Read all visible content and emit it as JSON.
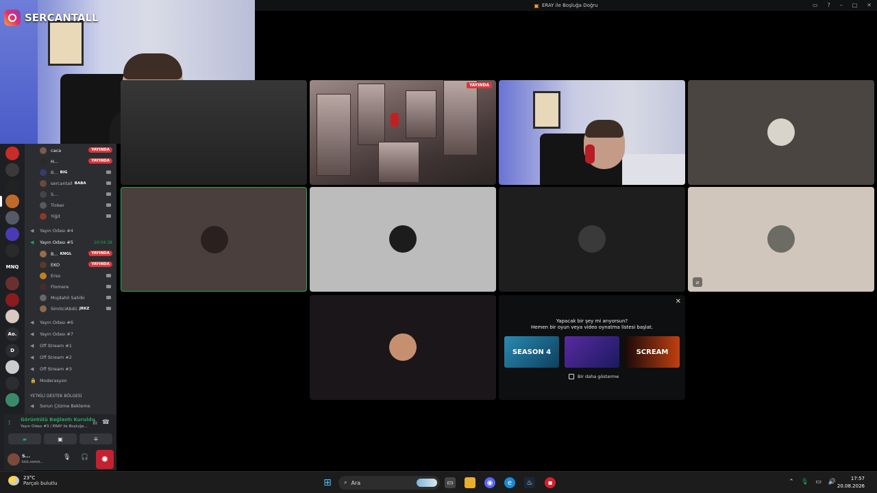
{
  "window": {
    "title": "ERAY ile Boşluğa Doğru"
  },
  "overlay": {
    "instagram_handle": "SERCANTALL"
  },
  "servers": [
    {
      "label": "",
      "color": "#c92a2a"
    },
    {
      "label": "",
      "color": "#3a3a3a"
    },
    {
      "label": "",
      "color": "#222222"
    },
    {
      "label": "",
      "color": "#c06a2a"
    },
    {
      "label": "",
      "color": "#555a66"
    },
    {
      "label": "",
      "color": "#4a3ab5"
    },
    {
      "label": "",
      "color": "#2a2a2a"
    },
    {
      "label": "MNQ",
      "color": "#1e1f22"
    },
    {
      "label": "",
      "color": "#6a3030"
    },
    {
      "label": "",
      "color": "#8a1c20"
    },
    {
      "label": "",
      "color": "#d9c9c0"
    },
    {
      "label": "Ao.",
      "color": "#2b2d31"
    },
    {
      "label": "D",
      "color": "#2b2d31"
    },
    {
      "label": "",
      "color": "#cccccc"
    },
    {
      "label": "",
      "color": "#2b2d31"
    },
    {
      "label": "",
      "color": "#3a8a6a"
    }
  ],
  "sidebar": {
    "top_users": [
      {
        "name": "caca",
        "badge": "YAYINDA"
      },
      {
        "name": "H...",
        "badge": "YAYINDA"
      },
      {
        "name": "B...",
        "tag": "BIG"
      },
      {
        "name": "sercantall",
        "tag": "BABA"
      },
      {
        "name": "S..."
      },
      {
        "name": "Tinker"
      },
      {
        "name": "Yiğit"
      }
    ],
    "channels_a": [
      {
        "name": "Yayın Odası #4"
      },
      {
        "name": "Yayın Odası #5",
        "timer": "10:04:38",
        "active": true
      }
    ],
    "room5_users": [
      {
        "name": "B...",
        "tag": "KNGL",
        "badge": "YAYINDA"
      },
      {
        "name": "EKO",
        "badge": "YAYINDA"
      },
      {
        "name": "Erso"
      },
      {
        "name": "Flomere"
      },
      {
        "name": "Mujdahil Sahibi"
      },
      {
        "name": "SimitciAbdü",
        "tag": "JRKZ"
      }
    ],
    "channels_b": [
      {
        "name": "Yayın Odası #6"
      },
      {
        "name": "Yayın Odası #7"
      },
      {
        "name": "Off Stream #1"
      },
      {
        "name": "Off Stream #2"
      },
      {
        "name": "Off Stream #3"
      },
      {
        "name": "Moderasyon"
      }
    ],
    "category": "YETKİLİ DESTEK BÖLGESİ",
    "category_channel": "Sorun Çözme Bekleme"
  },
  "voice_panel": {
    "status": "Görüntülü Bağlantı Kuruldu",
    "location": "Yayın Odası #3 / ERAY ile Boşluğa..."
  },
  "user_panel": {
    "name": "S...",
    "status": "kick.com/s..."
  },
  "stage": {
    "live_label": "YAYINDA",
    "tiles_avatars": [
      "#4a3f3c",
      "#2d2d2d",
      "#1e1e1e",
      "#bcbcbc",
      "#171717",
      "#171717",
      "#d0c6bc",
      "#1b1619"
    ]
  },
  "activity": {
    "heading": "Yapacak bir şey mi arıyorsun?",
    "subheading": "Hemen bir oyun veya video oynatma listesi başlat.",
    "games": [
      "SEASON 4",
      "",
      "SCREAM"
    ],
    "checkbox_label": "Bir daha gösterme"
  },
  "taskbar": {
    "temperature": "23°C",
    "weather": "Parçalı bulutlu",
    "search_placeholder": "Ara",
    "time": "17:57",
    "date": "20.08.2026"
  }
}
